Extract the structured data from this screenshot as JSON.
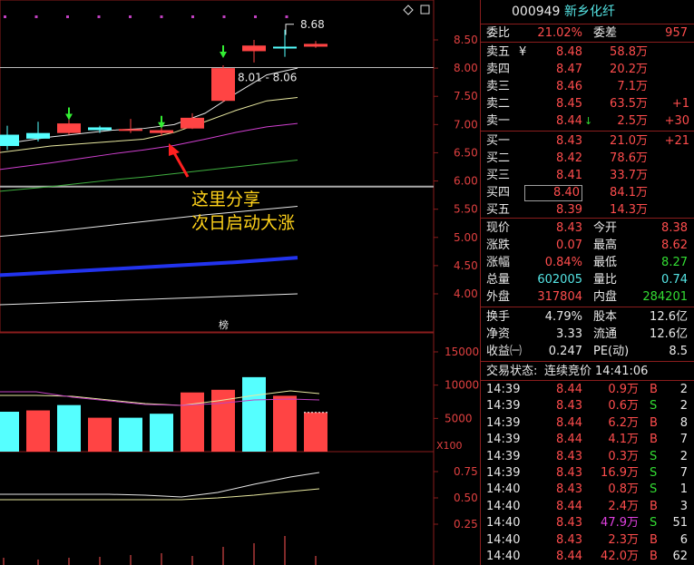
{
  "stock": {
    "code": "000949",
    "name": "新乡化纤"
  },
  "ratio": {
    "label_wb": "委比",
    "wb": "21.02%",
    "label_wc": "委差",
    "wc": "957"
  },
  "sell": [
    {
      "label": "卖五",
      "sym": "¥",
      "price": "8.48",
      "vol": "58.8万",
      "chg": ""
    },
    {
      "label": "卖四",
      "sym": "",
      "price": "8.47",
      "vol": "20.2万",
      "chg": ""
    },
    {
      "label": "卖三",
      "sym": "",
      "price": "8.46",
      "vol": "7.1万",
      "chg": ""
    },
    {
      "label": "卖二",
      "sym": "",
      "price": "8.45",
      "vol": "63.5万",
      "chg": "+1"
    },
    {
      "label": "卖一",
      "sym": "",
      "price": "8.44",
      "vol": "2.5万",
      "chg": "+30"
    }
  ],
  "buy": [
    {
      "label": "买一",
      "price": "8.43",
      "vol": "21.0万",
      "chg": "+21"
    },
    {
      "label": "买二",
      "price": "8.42",
      "vol": "78.6万",
      "chg": ""
    },
    {
      "label": "买三",
      "price": "8.41",
      "vol": "33.7万",
      "chg": ""
    },
    {
      "label": "买四",
      "price": "8.40",
      "vol": "84.1万",
      "chg": ""
    },
    {
      "label": "买五",
      "price": "8.39",
      "vol": "14.3万",
      "chg": ""
    }
  ],
  "quote": [
    {
      "l1": "现价",
      "v1": "8.43",
      "l2": "今开",
      "v2": "8.38"
    },
    {
      "l1": "涨跌",
      "v1": "0.07",
      "l2": "最高",
      "v2": "8.62"
    },
    {
      "l1": "涨幅",
      "v1": "0.84%",
      "l2": "最低",
      "v2": "8.27"
    },
    {
      "l1": "总量",
      "v1": "602005",
      "l2": "量比",
      "v2": "0.74"
    },
    {
      "l1": "外盘",
      "v1": "317804",
      "l2": "内盘",
      "v2": "284201"
    }
  ],
  "stats": [
    {
      "l1": "换手",
      "v1": "4.79%",
      "l2": "股本",
      "v2": "12.6亿"
    },
    {
      "l1": "净资",
      "v1": "3.33",
      "l2": "流通",
      "v2": "12.6亿"
    },
    {
      "l1": "收益㈠",
      "v1": "0.247",
      "l2": "PE(动)",
      "v2": "8.5"
    }
  ],
  "trade_status": {
    "label": "交易状态:",
    "value": "连续竞价",
    "time": "14:41:06"
  },
  "ticks": [
    {
      "t": "14:39",
      "p": "8.44",
      "v": "0.9万",
      "s": "B",
      "n": "2"
    },
    {
      "t": "14:39",
      "p": "8.43",
      "v": "0.6万",
      "s": "S",
      "n": "2"
    },
    {
      "t": "14:39",
      "p": "8.44",
      "v": "6.2万",
      "s": "B",
      "n": "8"
    },
    {
      "t": "14:39",
      "p": "8.44",
      "v": "4.1万",
      "s": "B",
      "n": "7"
    },
    {
      "t": "14:39",
      "p": "8.43",
      "v": "0.3万",
      "s": "S",
      "n": "2"
    },
    {
      "t": "14:39",
      "p": "8.43",
      "v": "16.9万",
      "s": "S",
      "n": "7"
    },
    {
      "t": "14:40",
      "p": "8.43",
      "v": "0.8万",
      "s": "S",
      "n": "1"
    },
    {
      "t": "14:40",
      "p": "8.44",
      "v": "2.4万",
      "s": "B",
      "n": "3"
    },
    {
      "t": "14:40",
      "p": "8.43",
      "v": "47.9万",
      "s": "S",
      "n": "51"
    },
    {
      "t": "14:40",
      "p": "8.43",
      "v": "2.3万",
      "s": "B",
      "n": "6"
    },
    {
      "t": "14:40",
      "p": "8.44",
      "v": "42.0万",
      "s": "B",
      "n": "62"
    }
  ],
  "chart_data": {
    "type": "candlestick",
    "price_axis": {
      "ticks": [
        "8.50",
        "8.00",
        "7.50",
        "7.00",
        "6.50",
        "6.00",
        "5.50",
        "5.00",
        "4.50",
        "4.00"
      ],
      "ylim": [
        3.75,
        8.9
      ]
    },
    "volume_axis": {
      "ticks": [
        "15000",
        "10000",
        "5000"
      ],
      "unit": "X100"
    },
    "indicator_axis": {
      "ticks": [
        "0.75",
        "0.50",
        "0.25"
      ]
    },
    "candles": [
      {
        "o": 6.82,
        "c": 6.62,
        "h": 6.98,
        "l": 6.55
      },
      {
        "o": 6.85,
        "c": 6.75,
        "h": 7.05,
        "l": 6.7
      },
      {
        "o": 6.85,
        "c": 7.02,
        "h": 7.1,
        "l": 6.82
      },
      {
        "o": 6.95,
        "c": 6.9,
        "h": 6.98,
        "l": 6.85
      },
      {
        "o": 6.9,
        "c": 6.92,
        "h": 7.1,
        "l": 6.85
      },
      {
        "o": 6.85,
        "c": 6.9,
        "h": 6.95,
        "l": 6.8
      },
      {
        "o": 6.93,
        "c": 7.12,
        "h": 7.2,
        "l": 6.92
      },
      {
        "o": 7.42,
        "c": 8.0,
        "h": 8.05,
        "l": 7.4
      },
      {
        "o": 8.3,
        "c": 8.4,
        "h": 8.5,
        "l": 8.1
      },
      {
        "o": 8.38,
        "c": 8.36,
        "h": 8.68,
        "l": 8.2
      },
      {
        "o": 8.38,
        "c": 8.43,
        "h": 8.48,
        "l": 8.36
      }
    ],
    "volume": [
      {
        "v": 6000,
        "up": false
      },
      {
        "v": 6200,
        "up": true
      },
      {
        "v": 7000,
        "up": false
      },
      {
        "v": 5100,
        "up": true
      },
      {
        "v": 5100,
        "up": false
      },
      {
        "v": 5700,
        "up": false
      },
      {
        "v": 8900,
        "up": true
      },
      {
        "v": 9300,
        "up": true
      },
      {
        "v": 11200,
        "up": false
      },
      {
        "v": 8400,
        "up": true
      },
      {
        "v": 5900,
        "up": true
      }
    ],
    "ma": [
      {
        "color": "#e8e8e8",
        "values": [
          6.62,
          6.7,
          6.78,
          6.84,
          6.9,
          6.93,
          7.0,
          7.2,
          7.55,
          7.88,
          8.0
        ]
      },
      {
        "color": "#e8e8a0",
        "values": [
          6.48,
          6.55,
          6.62,
          6.66,
          6.7,
          6.74,
          6.86,
          7.05,
          7.25,
          7.42,
          7.48
        ]
      },
      {
        "color": "#d040d0",
        "values": [
          6.18,
          6.25,
          6.32,
          6.4,
          6.48,
          6.55,
          6.63,
          6.74,
          6.86,
          6.96,
          7.02
        ]
      },
      {
        "color": "#40b040",
        "values": [
          5.8,
          5.85,
          5.9,
          5.96,
          6.02,
          6.07,
          6.13,
          6.19,
          6.25,
          6.31,
          6.37
        ]
      },
      {
        "color": "#e8e8e8",
        "values": [
          5.0,
          5.05,
          5.1,
          5.16,
          5.22,
          5.28,
          5.34,
          5.4,
          5.45,
          5.5,
          5.55
        ]
      },
      {
        "color": "#2233ee",
        "values": [
          4.32,
          4.35,
          4.38,
          4.41,
          4.44,
          4.47,
          4.5,
          4.53,
          4.56,
          4.6,
          4.64
        ]
      },
      {
        "color": "#e8e8e8",
        "values": [
          3.8,
          3.82,
          3.84,
          3.86,
          3.88,
          3.9,
          3.92,
          3.94,
          3.96,
          3.98,
          4.0
        ]
      }
    ],
    "range_label": "8.01 - 8.06",
    "peak_label": "8.68",
    "center_label": "榜"
  },
  "annotation": {
    "line1": "这里分享",
    "line2": "次日启动大涨"
  },
  "colors": {
    "up": "#ff4444",
    "down": "#55ffff",
    "border": "#8a1d1d"
  }
}
